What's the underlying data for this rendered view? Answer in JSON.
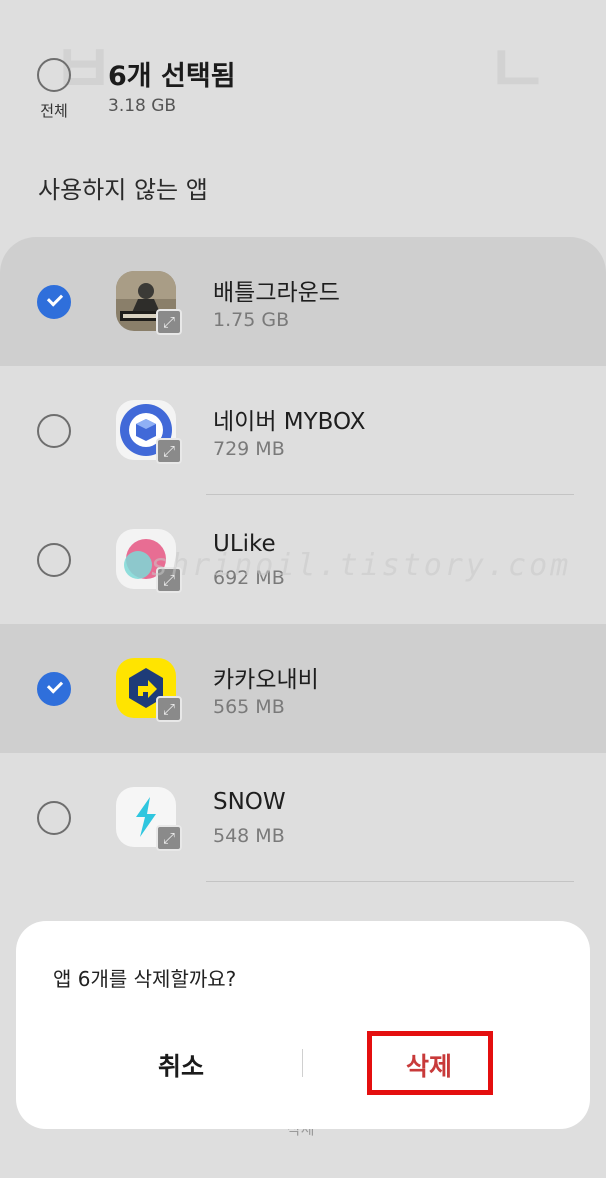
{
  "header": {
    "select_all_label": "전체",
    "selection_title": "6개 선택됨",
    "selection_size": "3.18 GB"
  },
  "section_title": "사용하지 않는 앱",
  "apps": [
    {
      "name": "배틀그라운드",
      "size": "1.75 GB",
      "checked": true,
      "icon": "pubg-icon"
    },
    {
      "name": "네이버 MYBOX",
      "size": "729 MB",
      "checked": false,
      "icon": "mybox-icon"
    },
    {
      "name": "ULike",
      "size": "692 MB",
      "checked": false,
      "icon": "ulike-icon"
    },
    {
      "name": "카카오내비",
      "size": "565 MB",
      "checked": true,
      "icon": "kakaonavi-icon"
    },
    {
      "name": "SNOW",
      "size": "548 MB",
      "checked": false,
      "icon": "snow-icon"
    }
  ],
  "dialog": {
    "message": "앱 6개를 삭제할까요?",
    "cancel_label": "취소",
    "delete_label": "삭제"
  },
  "bottom_ghost_label": "삭제",
  "watermark": "shrinoil.tistory.com",
  "colors": {
    "accent": "#2f6fdb",
    "delete": "#c83a3a",
    "highlight": "#e40f0f"
  }
}
